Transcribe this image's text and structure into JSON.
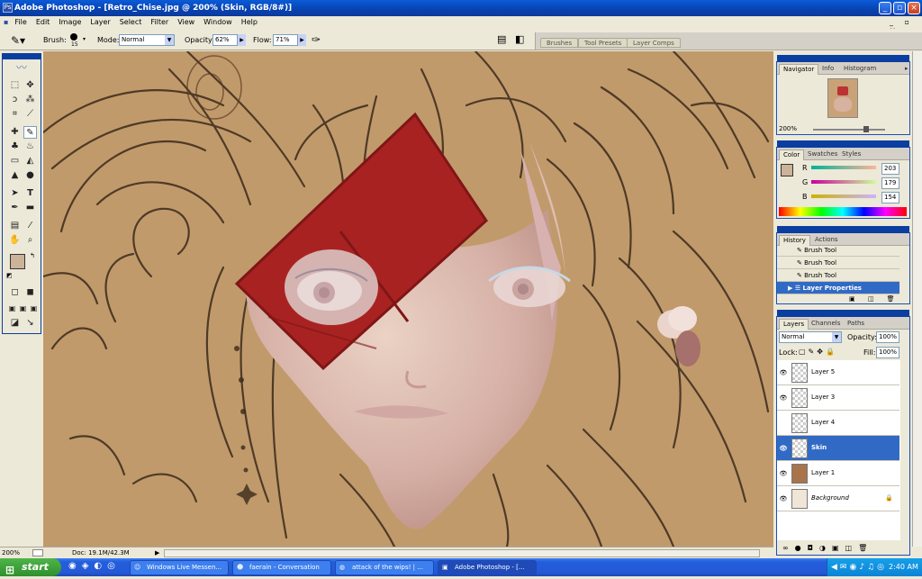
{
  "window": {
    "title": "Adobe Photoshop - [Retro_Chise.jpg @ 200% (Skin, RGB/8#)]"
  },
  "menu": [
    "File",
    "Edit",
    "Image",
    "Layer",
    "Select",
    "Filter",
    "View",
    "Window",
    "Help"
  ],
  "options": {
    "brush_label": "Brush:",
    "brush_size": "15",
    "mode_label": "Mode:",
    "mode_value": "Normal",
    "opacity_label": "Opacity:",
    "opacity_value": "62%",
    "flow_label": "Flow:",
    "flow_value": "71%"
  },
  "palette_well": [
    "Brushes",
    "Tool Presets",
    "Layer Comps"
  ],
  "navigator": {
    "tabs": [
      "Navigator",
      "Info",
      "Histogram"
    ],
    "zoom": "200%"
  },
  "color": {
    "tabs": [
      "Color",
      "Swatches",
      "Styles"
    ],
    "r_label": "R",
    "g_label": "G",
    "b_label": "B",
    "r": "203",
    "g": "179",
    "b": "154",
    "foreground": "#cbb39a"
  },
  "history": {
    "tabs": [
      "History",
      "Actions"
    ],
    "items": [
      "Brush Tool",
      "Brush Tool",
      "Brush Tool",
      "Layer Properties"
    ]
  },
  "layers": {
    "tabs": [
      "Layers",
      "Channels",
      "Paths"
    ],
    "blend_mode": "Normal",
    "opacity_label": "Opacity:",
    "opacity": "100%",
    "lock_label": "Lock:",
    "fill_label": "Fill:",
    "fill": "100%",
    "items": [
      "Layer 5",
      "Layer 3",
      "Layer 4",
      "Skin",
      "Layer 1",
      "Background"
    ]
  },
  "status": {
    "zoom": "200%",
    "doc": "Doc: 19.1M/42.3M"
  },
  "taskbar": {
    "start": "start",
    "tasks": [
      "Windows Live Messen...",
      "faerain - Conversation",
      "attack of the wips! | ...",
      "Adobe Photoshop - [..."
    ],
    "clock": "2:40 AM"
  },
  "colors": {
    "accent": "#0a3ea0",
    "selected_layer": "#316ac5",
    "canvas_paper": "#c19a6b",
    "red_shape": "#a92222"
  }
}
